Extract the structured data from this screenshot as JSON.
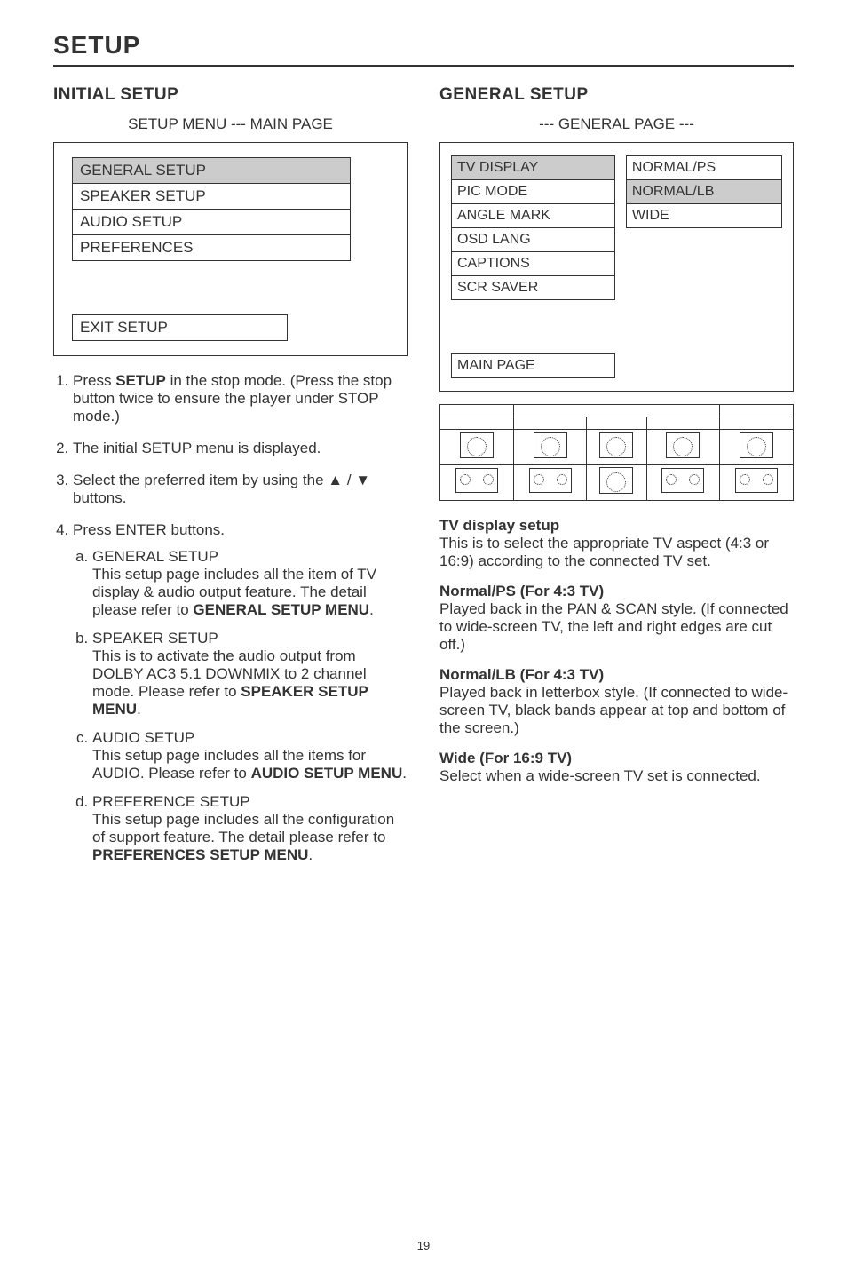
{
  "page_title": "SETUP",
  "left": {
    "section_head": "INITIAL SETUP",
    "subhead": "SETUP MENU --- MAIN PAGE",
    "menu_items": [
      {
        "label": "GENERAL SETUP",
        "selected": true
      },
      {
        "label": "SPEAKER SETUP",
        "selected": false
      },
      {
        "label": "AUDIO SETUP",
        "selected": false
      },
      {
        "label": "PREFERENCES",
        "selected": false
      }
    ],
    "exit_label": "EXIT SETUP",
    "steps": {
      "s1_a": "Press ",
      "s1_b": "SETUP",
      "s1_c": " in the stop mode. (Press the stop button twice to ensure the player under STOP mode.)",
      "s2": "The initial SETUP menu is displayed.",
      "s3": "Select the preferred item by using the ▲ / ▼ buttons.",
      "s4": "Press ENTER buttons.",
      "subs": [
        {
          "title": "GENERAL SETUP",
          "body_a": "This setup page includes all the item of TV display & audio output feature.  The detail please refer to ",
          "body_b": "GENERAL SETUP MENU",
          "body_c": "."
        },
        {
          "title": "SPEAKER SETUP",
          "body_a": "This is to activate the audio output from DOLBY AC3 5.1 DOWNMIX to 2 channel mode.  Please refer to ",
          "body_b": "SPEAKER SETUP MENU",
          "body_c": "."
        },
        {
          "title": "AUDIO SETUP",
          "body_a": "This setup page includes all the items for AUDIO.  Please refer to ",
          "body_b": "AUDIO SETUP MENU",
          "body_c": "."
        },
        {
          "title": "PREFERENCE SETUP",
          "body_a": "This setup page includes all the configuration of support feature.  The detail please refer to ",
          "body_b": "PREFERENCES SETUP MENU",
          "body_c": "."
        }
      ]
    }
  },
  "right": {
    "section_head": "GENERAL SETUP",
    "subhead": "--- GENERAL PAGE ---",
    "left_items": [
      {
        "label": "TV DISPLAY",
        "selected": true
      },
      {
        "label": "PIC MODE",
        "selected": false
      },
      {
        "label": "ANGLE MARK",
        "selected": false
      },
      {
        "label": "OSD LANG",
        "selected": false
      },
      {
        "label": "CAPTIONS",
        "selected": false
      },
      {
        "label": "SCR SAVER",
        "selected": false
      }
    ],
    "right_items": [
      {
        "label": "NORMAL/PS",
        "selected": false
      },
      {
        "label": "NORMAL/LB",
        "selected": true
      },
      {
        "label": "WIDE",
        "selected": false
      }
    ],
    "main_page": "MAIN PAGE",
    "body": {
      "tv_head": "TV display setup",
      "tv_body": "This is to select the appropriate TV aspect (4:3 or 16:9) according to the connected TV set.",
      "nps_head": "Normal/PS (For 4:3 TV)",
      "nps_body": "Played back in the PAN & SCAN style. (If connected to wide-screen TV, the left and right edges are cut off.)",
      "nlb_head": "Normal/LB (For 4:3 TV)",
      "nlb_body": "Played back in letterbox style. (If connected to wide-screen TV, black bands appear at top and bottom of the screen.)",
      "wide_head": "Wide (For 16:9 TV)",
      "wide_body": "Select when a wide-screen TV set is connected."
    }
  },
  "page_number": "19"
}
